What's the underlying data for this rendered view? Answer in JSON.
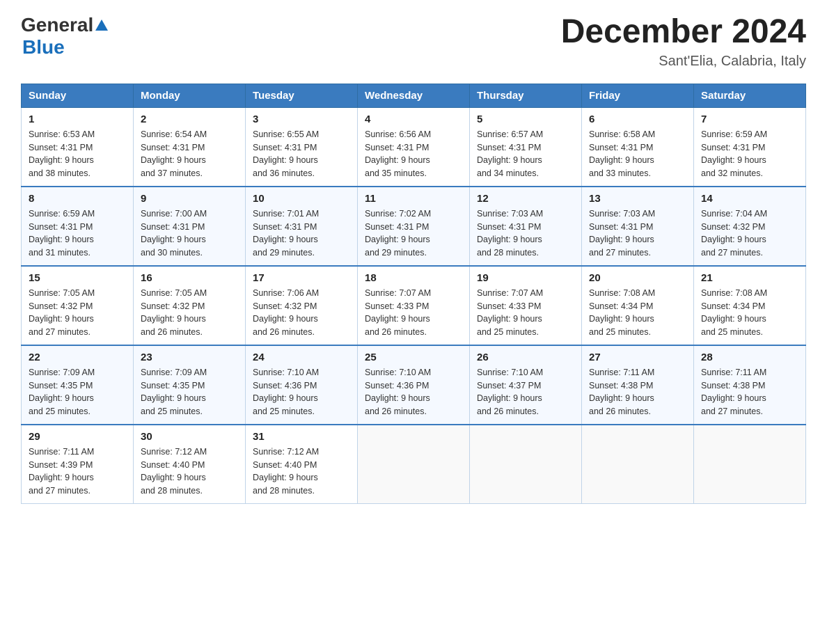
{
  "header": {
    "logo_general": "General",
    "logo_blue": "Blue",
    "month_title": "December 2024",
    "subtitle": "Sant'Elia, Calabria, Italy"
  },
  "days_of_week": [
    "Sunday",
    "Monday",
    "Tuesday",
    "Wednesday",
    "Thursday",
    "Friday",
    "Saturday"
  ],
  "weeks": [
    [
      {
        "day": "1",
        "sunrise": "6:53 AM",
        "sunset": "4:31 PM",
        "daylight": "9 hours and 38 minutes."
      },
      {
        "day": "2",
        "sunrise": "6:54 AM",
        "sunset": "4:31 PM",
        "daylight": "9 hours and 37 minutes."
      },
      {
        "day": "3",
        "sunrise": "6:55 AM",
        "sunset": "4:31 PM",
        "daylight": "9 hours and 36 minutes."
      },
      {
        "day": "4",
        "sunrise": "6:56 AM",
        "sunset": "4:31 PM",
        "daylight": "9 hours and 35 minutes."
      },
      {
        "day": "5",
        "sunrise": "6:57 AM",
        "sunset": "4:31 PM",
        "daylight": "9 hours and 34 minutes."
      },
      {
        "day": "6",
        "sunrise": "6:58 AM",
        "sunset": "4:31 PM",
        "daylight": "9 hours and 33 minutes."
      },
      {
        "day": "7",
        "sunrise": "6:59 AM",
        "sunset": "4:31 PM",
        "daylight": "9 hours and 32 minutes."
      }
    ],
    [
      {
        "day": "8",
        "sunrise": "6:59 AM",
        "sunset": "4:31 PM",
        "daylight": "9 hours and 31 minutes."
      },
      {
        "day": "9",
        "sunrise": "7:00 AM",
        "sunset": "4:31 PM",
        "daylight": "9 hours and 30 minutes."
      },
      {
        "day": "10",
        "sunrise": "7:01 AM",
        "sunset": "4:31 PM",
        "daylight": "9 hours and 29 minutes."
      },
      {
        "day": "11",
        "sunrise": "7:02 AM",
        "sunset": "4:31 PM",
        "daylight": "9 hours and 29 minutes."
      },
      {
        "day": "12",
        "sunrise": "7:03 AM",
        "sunset": "4:31 PM",
        "daylight": "9 hours and 28 minutes."
      },
      {
        "day": "13",
        "sunrise": "7:03 AM",
        "sunset": "4:31 PM",
        "daylight": "9 hours and 27 minutes."
      },
      {
        "day": "14",
        "sunrise": "7:04 AM",
        "sunset": "4:32 PM",
        "daylight": "9 hours and 27 minutes."
      }
    ],
    [
      {
        "day": "15",
        "sunrise": "7:05 AM",
        "sunset": "4:32 PM",
        "daylight": "9 hours and 27 minutes."
      },
      {
        "day": "16",
        "sunrise": "7:05 AM",
        "sunset": "4:32 PM",
        "daylight": "9 hours and 26 minutes."
      },
      {
        "day": "17",
        "sunrise": "7:06 AM",
        "sunset": "4:32 PM",
        "daylight": "9 hours and 26 minutes."
      },
      {
        "day": "18",
        "sunrise": "7:07 AM",
        "sunset": "4:33 PM",
        "daylight": "9 hours and 26 minutes."
      },
      {
        "day": "19",
        "sunrise": "7:07 AM",
        "sunset": "4:33 PM",
        "daylight": "9 hours and 25 minutes."
      },
      {
        "day": "20",
        "sunrise": "7:08 AM",
        "sunset": "4:34 PM",
        "daylight": "9 hours and 25 minutes."
      },
      {
        "day": "21",
        "sunrise": "7:08 AM",
        "sunset": "4:34 PM",
        "daylight": "9 hours and 25 minutes."
      }
    ],
    [
      {
        "day": "22",
        "sunrise": "7:09 AM",
        "sunset": "4:35 PM",
        "daylight": "9 hours and 25 minutes."
      },
      {
        "day": "23",
        "sunrise": "7:09 AM",
        "sunset": "4:35 PM",
        "daylight": "9 hours and 25 minutes."
      },
      {
        "day": "24",
        "sunrise": "7:10 AM",
        "sunset": "4:36 PM",
        "daylight": "9 hours and 25 minutes."
      },
      {
        "day": "25",
        "sunrise": "7:10 AM",
        "sunset": "4:36 PM",
        "daylight": "9 hours and 26 minutes."
      },
      {
        "day": "26",
        "sunrise": "7:10 AM",
        "sunset": "4:37 PM",
        "daylight": "9 hours and 26 minutes."
      },
      {
        "day": "27",
        "sunrise": "7:11 AM",
        "sunset": "4:38 PM",
        "daylight": "9 hours and 26 minutes."
      },
      {
        "day": "28",
        "sunrise": "7:11 AM",
        "sunset": "4:38 PM",
        "daylight": "9 hours and 27 minutes."
      }
    ],
    [
      {
        "day": "29",
        "sunrise": "7:11 AM",
        "sunset": "4:39 PM",
        "daylight": "9 hours and 27 minutes."
      },
      {
        "day": "30",
        "sunrise": "7:12 AM",
        "sunset": "4:40 PM",
        "daylight": "9 hours and 28 minutes."
      },
      {
        "day": "31",
        "sunrise": "7:12 AM",
        "sunset": "4:40 PM",
        "daylight": "9 hours and 28 minutes."
      },
      null,
      null,
      null,
      null
    ]
  ],
  "labels": {
    "sunrise_prefix": "Sunrise: ",
    "sunset_prefix": "Sunset: ",
    "daylight_prefix": "Daylight: "
  }
}
